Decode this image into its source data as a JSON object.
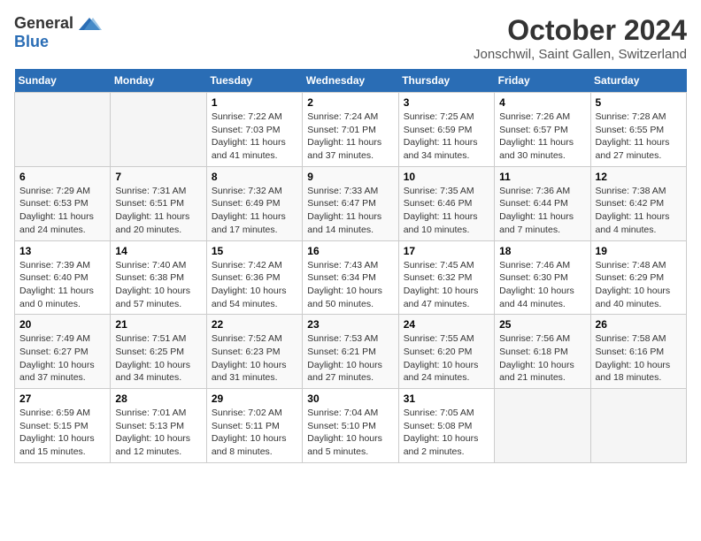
{
  "header": {
    "logo_general": "General",
    "logo_blue": "Blue",
    "title": "October 2024",
    "subtitle": "Jonschwil, Saint Gallen, Switzerland"
  },
  "days_of_week": [
    "Sunday",
    "Monday",
    "Tuesday",
    "Wednesday",
    "Thursday",
    "Friday",
    "Saturday"
  ],
  "weeks": [
    [
      {
        "day": "",
        "info": ""
      },
      {
        "day": "",
        "info": ""
      },
      {
        "day": "1",
        "info": "Sunrise: 7:22 AM\nSunset: 7:03 PM\nDaylight: 11 hours and 41 minutes."
      },
      {
        "day": "2",
        "info": "Sunrise: 7:24 AM\nSunset: 7:01 PM\nDaylight: 11 hours and 37 minutes."
      },
      {
        "day": "3",
        "info": "Sunrise: 7:25 AM\nSunset: 6:59 PM\nDaylight: 11 hours and 34 minutes."
      },
      {
        "day": "4",
        "info": "Sunrise: 7:26 AM\nSunset: 6:57 PM\nDaylight: 11 hours and 30 minutes."
      },
      {
        "day": "5",
        "info": "Sunrise: 7:28 AM\nSunset: 6:55 PM\nDaylight: 11 hours and 27 minutes."
      }
    ],
    [
      {
        "day": "6",
        "info": "Sunrise: 7:29 AM\nSunset: 6:53 PM\nDaylight: 11 hours and 24 minutes."
      },
      {
        "day": "7",
        "info": "Sunrise: 7:31 AM\nSunset: 6:51 PM\nDaylight: 11 hours and 20 minutes."
      },
      {
        "day": "8",
        "info": "Sunrise: 7:32 AM\nSunset: 6:49 PM\nDaylight: 11 hours and 17 minutes."
      },
      {
        "day": "9",
        "info": "Sunrise: 7:33 AM\nSunset: 6:47 PM\nDaylight: 11 hours and 14 minutes."
      },
      {
        "day": "10",
        "info": "Sunrise: 7:35 AM\nSunset: 6:46 PM\nDaylight: 11 hours and 10 minutes."
      },
      {
        "day": "11",
        "info": "Sunrise: 7:36 AM\nSunset: 6:44 PM\nDaylight: 11 hours and 7 minutes."
      },
      {
        "day": "12",
        "info": "Sunrise: 7:38 AM\nSunset: 6:42 PM\nDaylight: 11 hours and 4 minutes."
      }
    ],
    [
      {
        "day": "13",
        "info": "Sunrise: 7:39 AM\nSunset: 6:40 PM\nDaylight: 11 hours and 0 minutes."
      },
      {
        "day": "14",
        "info": "Sunrise: 7:40 AM\nSunset: 6:38 PM\nDaylight: 10 hours and 57 minutes."
      },
      {
        "day": "15",
        "info": "Sunrise: 7:42 AM\nSunset: 6:36 PM\nDaylight: 10 hours and 54 minutes."
      },
      {
        "day": "16",
        "info": "Sunrise: 7:43 AM\nSunset: 6:34 PM\nDaylight: 10 hours and 50 minutes."
      },
      {
        "day": "17",
        "info": "Sunrise: 7:45 AM\nSunset: 6:32 PM\nDaylight: 10 hours and 47 minutes."
      },
      {
        "day": "18",
        "info": "Sunrise: 7:46 AM\nSunset: 6:30 PM\nDaylight: 10 hours and 44 minutes."
      },
      {
        "day": "19",
        "info": "Sunrise: 7:48 AM\nSunset: 6:29 PM\nDaylight: 10 hours and 40 minutes."
      }
    ],
    [
      {
        "day": "20",
        "info": "Sunrise: 7:49 AM\nSunset: 6:27 PM\nDaylight: 10 hours and 37 minutes."
      },
      {
        "day": "21",
        "info": "Sunrise: 7:51 AM\nSunset: 6:25 PM\nDaylight: 10 hours and 34 minutes."
      },
      {
        "day": "22",
        "info": "Sunrise: 7:52 AM\nSunset: 6:23 PM\nDaylight: 10 hours and 31 minutes."
      },
      {
        "day": "23",
        "info": "Sunrise: 7:53 AM\nSunset: 6:21 PM\nDaylight: 10 hours and 27 minutes."
      },
      {
        "day": "24",
        "info": "Sunrise: 7:55 AM\nSunset: 6:20 PM\nDaylight: 10 hours and 24 minutes."
      },
      {
        "day": "25",
        "info": "Sunrise: 7:56 AM\nSunset: 6:18 PM\nDaylight: 10 hours and 21 minutes."
      },
      {
        "day": "26",
        "info": "Sunrise: 7:58 AM\nSunset: 6:16 PM\nDaylight: 10 hours and 18 minutes."
      }
    ],
    [
      {
        "day": "27",
        "info": "Sunrise: 6:59 AM\nSunset: 5:15 PM\nDaylight: 10 hours and 15 minutes."
      },
      {
        "day": "28",
        "info": "Sunrise: 7:01 AM\nSunset: 5:13 PM\nDaylight: 10 hours and 12 minutes."
      },
      {
        "day": "29",
        "info": "Sunrise: 7:02 AM\nSunset: 5:11 PM\nDaylight: 10 hours and 8 minutes."
      },
      {
        "day": "30",
        "info": "Sunrise: 7:04 AM\nSunset: 5:10 PM\nDaylight: 10 hours and 5 minutes."
      },
      {
        "day": "31",
        "info": "Sunrise: 7:05 AM\nSunset: 5:08 PM\nDaylight: 10 hours and 2 minutes."
      },
      {
        "day": "",
        "info": ""
      },
      {
        "day": "",
        "info": ""
      }
    ]
  ]
}
